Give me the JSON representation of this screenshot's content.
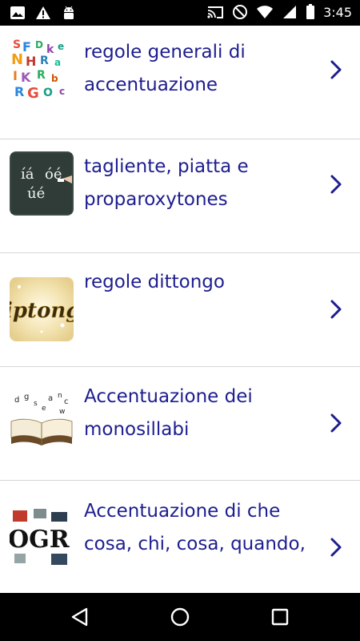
{
  "status_bar": {
    "time": "3:45",
    "left_icons": [
      "image-icon",
      "warning-icon",
      "android-icon"
    ],
    "right_icons": [
      "cast-icon",
      "do-not-disturb-icon",
      "wifi-icon",
      "signal-icon",
      "battery-icon"
    ]
  },
  "list": {
    "items": [
      {
        "label": "regole generali di accentuazione",
        "icon": "letters-thumbnail"
      },
      {
        "label": "tagliente, piatta e proparoxytones",
        "icon": "chalkboard-thumbnail",
        "chalk_text": "íá óé úé"
      },
      {
        "label": "regole dittongo",
        "icon": "dittongo-thumbnail",
        "logo_text": "iptong"
      },
      {
        "label": "Accentuazione dei monosillabi",
        "icon": "book-thumbnail"
      },
      {
        "label": "Accentuazione di che cosa, chi, cosa, quando,",
        "icon": "collage-thumbnail",
        "logo_text": "OGR"
      }
    ]
  },
  "colors": {
    "label": "#1d1d8f",
    "chevron": "#1d1d8f",
    "divider": "#d6d6d6",
    "bars": "#000000"
  },
  "nav_bar": {
    "buttons": [
      "back-icon",
      "home-icon",
      "recents-icon"
    ]
  }
}
